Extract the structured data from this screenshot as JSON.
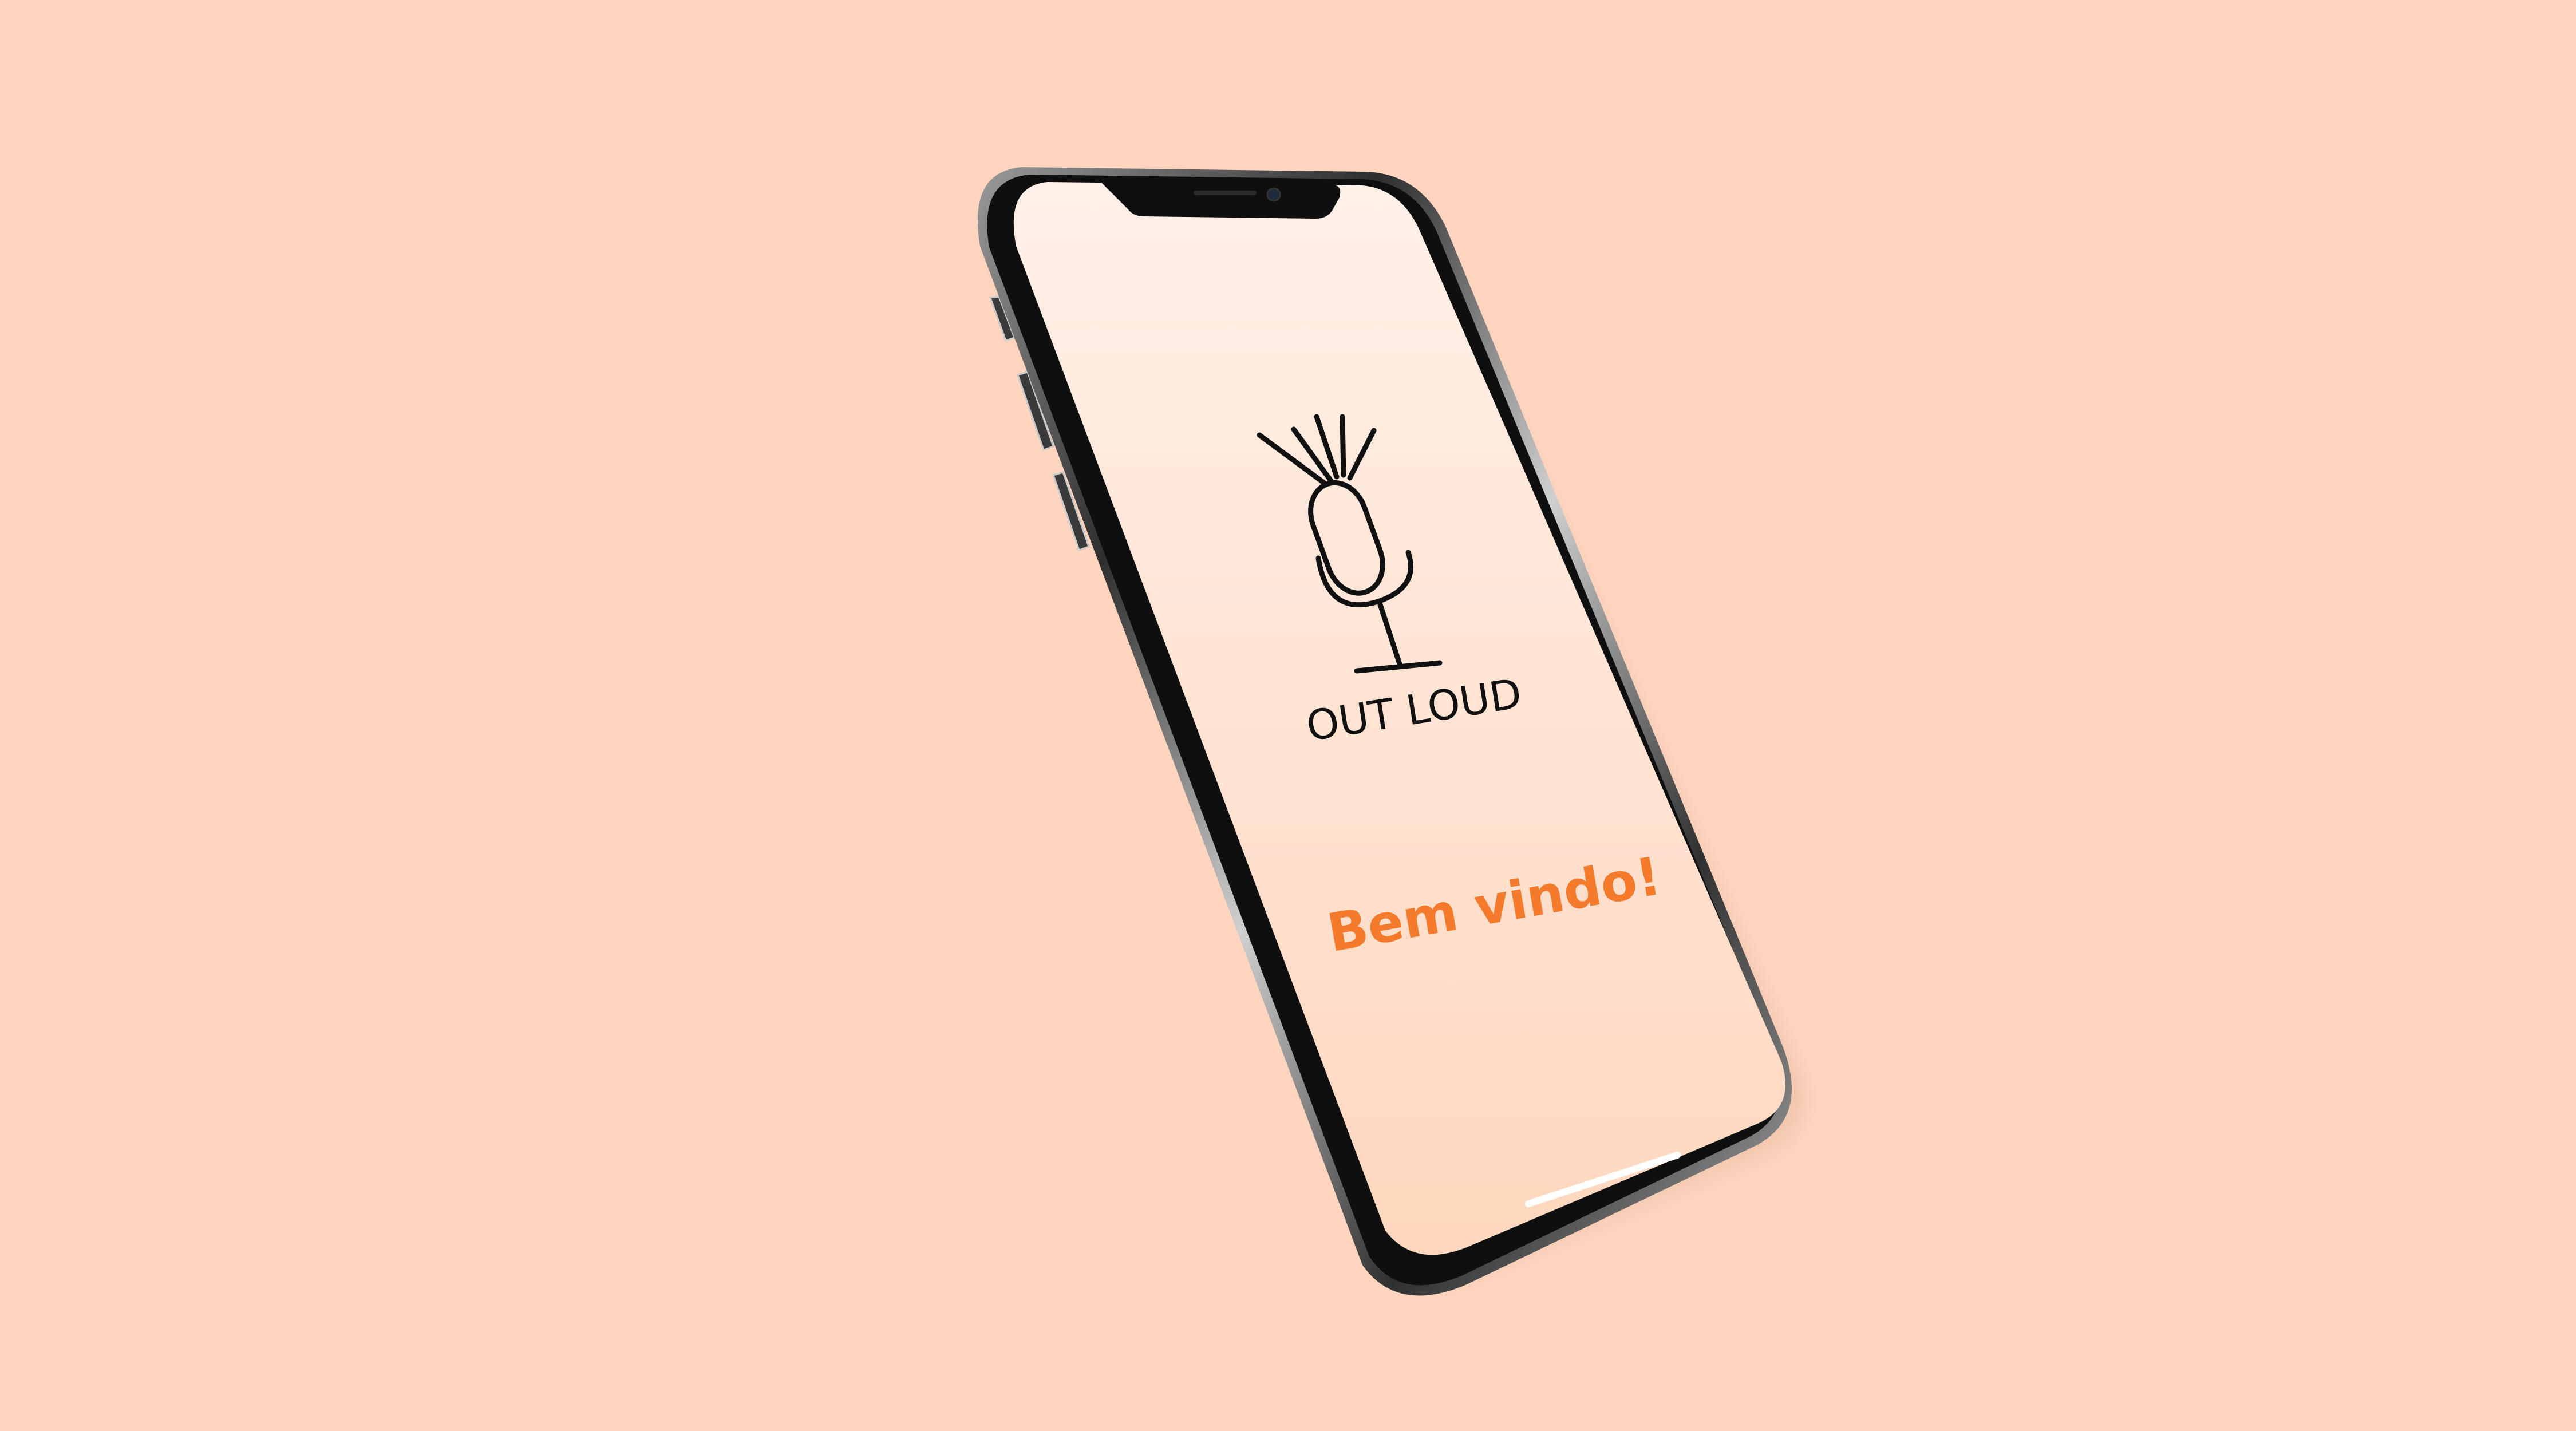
{
  "colors": {
    "background": "#ffd5bf",
    "screen_top": "#fff0e8",
    "screen_bottom": "#ffd7be",
    "accent": "#f47a2c",
    "logo_ink": "#111111"
  },
  "app": {
    "brand_name": "OUT LOUD",
    "welcome_text": "Bem vindo!",
    "logo_icon": "microphone-icon"
  }
}
